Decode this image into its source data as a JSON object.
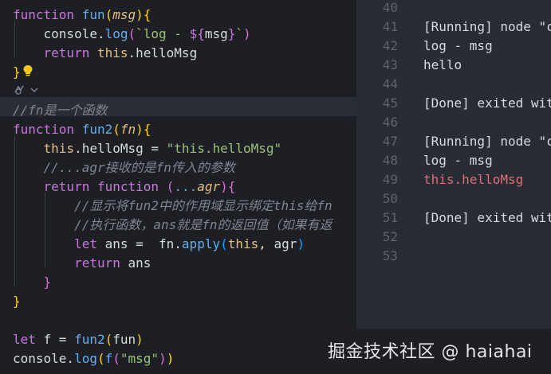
{
  "editor": {
    "lines": [
      {
        "parts": [
          [
            "kw",
            "function "
          ],
          [
            "fn",
            "fun"
          ],
          [
            "br1",
            "("
          ],
          [
            "prm",
            "msg"
          ],
          [
            "br1",
            "){"
          ]
        ]
      },
      {
        "parts": [
          [
            "",
            "    console."
          ],
          [
            "fn",
            "log"
          ],
          [
            "br2",
            "("
          ],
          [
            "tmpl",
            "`log - "
          ],
          [
            "interp",
            "${"
          ],
          [
            "",
            "msg"
          ],
          [
            "interp",
            "}"
          ],
          [
            "tmpl",
            "`"
          ],
          [
            "br2",
            ")"
          ]
        ]
      },
      {
        "parts": [
          [
            "",
            "    "
          ],
          [
            "kw",
            "return "
          ],
          [
            "this",
            "this"
          ],
          [
            "",
            ".helloMsg"
          ]
        ]
      },
      {
        "parts": [
          [
            "br1",
            "}"
          ]
        ]
      },
      {
        "parts": []
      },
      {
        "parts": [
          [
            "cmt",
            "//fn是一个函数"
          ]
        ]
      },
      {
        "parts": [
          [
            "kw",
            "function "
          ],
          [
            "fn",
            "fun2"
          ],
          [
            "br1",
            "("
          ],
          [
            "prm",
            "fn"
          ],
          [
            "br1",
            "){"
          ]
        ]
      },
      {
        "parts": [
          [
            "",
            "    "
          ],
          [
            "this",
            "this"
          ],
          [
            "",
            ".helloMsg = "
          ],
          [
            "str",
            "\"this.helloMsg\""
          ]
        ]
      },
      {
        "parts": [
          [
            "",
            "    "
          ],
          [
            "cmt",
            "//...agr接收的是fn传入的参数"
          ]
        ]
      },
      {
        "parts": [
          [
            "",
            "    "
          ],
          [
            "kw",
            "return "
          ],
          [
            "kw",
            "function "
          ],
          [
            "br2",
            "("
          ],
          [
            "op",
            "..."
          ],
          [
            "prm",
            "agr"
          ],
          [
            "br2",
            "){"
          ]
        ]
      },
      {
        "parts": [
          [
            "",
            "        "
          ],
          [
            "cmt",
            "//显示将fun2中的作用域显示绑定this给fn"
          ]
        ]
      },
      {
        "parts": [
          [
            "",
            "        "
          ],
          [
            "cmt",
            "//执行函数，ans就是fn的返回值（如果有返"
          ]
        ]
      },
      {
        "parts": [
          [
            "",
            "        "
          ],
          [
            "kw",
            "let "
          ],
          [
            "",
            "ans =  fn."
          ],
          [
            "fn",
            "apply"
          ],
          [
            "br3",
            "("
          ],
          [
            "this",
            "this"
          ],
          [
            "",
            ", agr"
          ],
          [
            "br3",
            ")"
          ]
        ]
      },
      {
        "parts": [
          [
            "",
            "        "
          ],
          [
            "kw",
            "return "
          ],
          [
            "",
            "ans"
          ]
        ]
      },
      {
        "parts": [
          [
            "",
            "    "
          ],
          [
            "br2",
            "}"
          ]
        ]
      },
      {
        "parts": [
          [
            "br1",
            "}"
          ]
        ]
      },
      {
        "parts": []
      },
      {
        "parts": [
          [
            "kw",
            "let "
          ],
          [
            "",
            "f = "
          ],
          [
            "fn",
            "fun2"
          ],
          [
            "br1",
            "("
          ],
          [
            "",
            "fun"
          ],
          [
            "br1",
            ")"
          ]
        ]
      },
      {
        "parts": [
          [
            "",
            "console."
          ],
          [
            "fn",
            "log"
          ],
          [
            "br1",
            "("
          ],
          [
            "fn",
            "f"
          ],
          [
            "br2",
            "("
          ],
          [
            "str",
            "\"msg\""
          ],
          [
            "br2",
            ")"
          ],
          [
            "br1",
            ")"
          ]
        ]
      }
    ]
  },
  "output": {
    "lines": [
      {
        "num": "40",
        "text": "",
        "style": ""
      },
      {
        "num": "41",
        "text": "[Running] node \"c",
        "style": ""
      },
      {
        "num": "42",
        "text": "log - msg",
        "style": ""
      },
      {
        "num": "43",
        "text": "hello",
        "style": ""
      },
      {
        "num": "44",
        "text": "",
        "style": ""
      },
      {
        "num": "45",
        "text": "[Done] exited wit",
        "style": ""
      },
      {
        "num": "46",
        "text": "",
        "style": ""
      },
      {
        "num": "47",
        "text": "[Running] node \"c",
        "style": ""
      },
      {
        "num": "48",
        "text": "log - msg",
        "style": ""
      },
      {
        "num": "49",
        "text": "this.helloMsg",
        "style": "red"
      },
      {
        "num": "50",
        "text": "",
        "style": ""
      },
      {
        "num": "51",
        "text": "[Done] exited wit",
        "style": ""
      },
      {
        "num": "52",
        "text": "",
        "style": ""
      },
      {
        "num": "53",
        "text": "",
        "style": ""
      }
    ]
  },
  "watermark": "掘金技术社区 @ haiahai",
  "icons": {
    "lightbulb": "lightbulb-icon",
    "codelens": "codelens-icon"
  }
}
